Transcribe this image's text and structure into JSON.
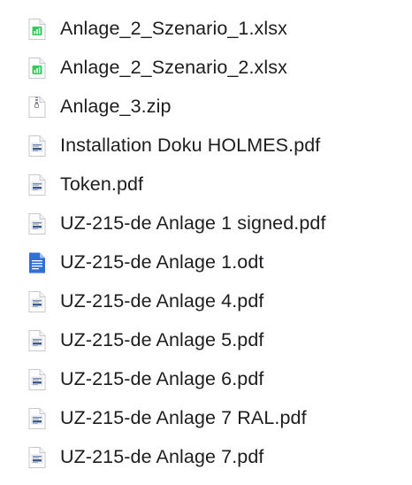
{
  "files": [
    {
      "name": "Anlage_2_Szenario_1.xlsx",
      "icon": "xlsx-icon",
      "kind": "xlsx"
    },
    {
      "name": "Anlage_2_Szenario_2.xlsx",
      "icon": "xlsx-icon",
      "kind": "xlsx"
    },
    {
      "name": "Anlage_3.zip",
      "icon": "zip-icon",
      "kind": "zip"
    },
    {
      "name": "Installation Doku HOLMES.pdf",
      "icon": "pdf-icon",
      "kind": "pdf"
    },
    {
      "name": "Token.pdf",
      "icon": "pdf-icon",
      "kind": "pdf"
    },
    {
      "name": "UZ-215-de Anlage 1 signed.pdf",
      "icon": "pdf-icon",
      "kind": "pdf"
    },
    {
      "name": "UZ-215-de Anlage 1.odt",
      "icon": "odt-icon",
      "kind": "odt"
    },
    {
      "name": "UZ-215-de Anlage 4.pdf",
      "icon": "pdf-icon",
      "kind": "pdf"
    },
    {
      "name": "UZ-215-de Anlage 5.pdf",
      "icon": "pdf-icon",
      "kind": "pdf"
    },
    {
      "name": "UZ-215-de Anlage 6.pdf",
      "icon": "pdf-icon",
      "kind": "pdf"
    },
    {
      "name": "UZ-215-de Anlage 7 RAL.pdf",
      "icon": "pdf-icon",
      "kind": "pdf"
    },
    {
      "name": "UZ-215-de Anlage 7.pdf",
      "icon": "pdf-icon",
      "kind": "pdf"
    }
  ],
  "colors": {
    "text": "#1d1d1f",
    "xlsx_accent": "#34c759",
    "odt_accent": "#2f6fd6",
    "pdf_accent": "#3a5a8c",
    "zip_accent": "#8e8e93"
  }
}
